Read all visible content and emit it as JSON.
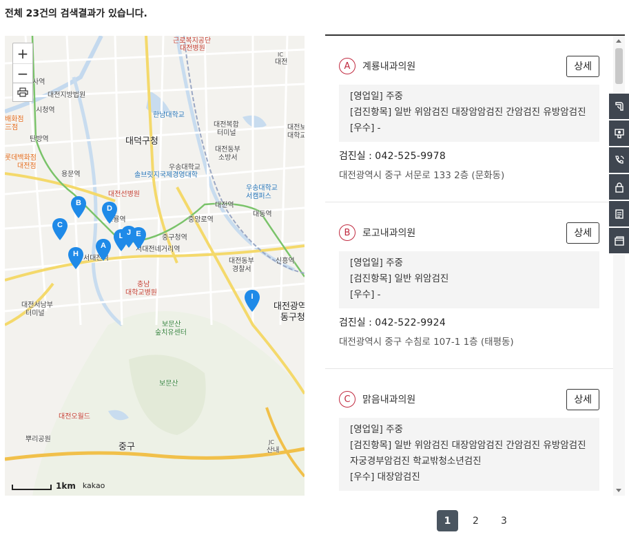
{
  "summary": "전체 23건의 검색결과가 있습니다.",
  "map": {
    "zoom_in": "+",
    "zoom_out": "−",
    "scale": "1km",
    "provider": "kakao",
    "labels": {
      "geunro": "근로복지공단",
      "daejeon_hosp": "대전병원",
      "ic": "IC",
      "daejeon_r": "대전",
      "sayeok": "사역",
      "court": "대전지방법원",
      "city_hall": "시청역",
      "hannam": "한남대학교",
      "terminal": "대전복합",
      "terminal2": "터미널",
      "dept_store": "대전보",
      "dept_store2": "대학교",
      "baekhwa": "배화점",
      "three": "三점",
      "tanbang": "탄방역",
      "daedeok": "대덕구청",
      "dongbu": "대전동부",
      "fire": "소방서",
      "lotte": "롯데백화점",
      "lotte2": "대전점",
      "woosong": "우송대학교",
      "sol": "솔브릿지국제경영대학",
      "yongmun": "용문역",
      "seon_hosp": "대전선병원",
      "woosong2": "우송대학교",
      "woosong2b": "서캠퍼스",
      "daejeon_st": "대전역",
      "dong_st": "대동역",
      "ojeong": "오룡역",
      "jungang": "중앙로역",
      "junggu": "중구청역",
      "seodae": "서대전역",
      "negeori": "서대전네거리역",
      "dongbu_police": "대전동부",
      "dongbu_police2": "경찰서",
      "sinheung": "신흥역",
      "chungnam": "충남",
      "chungnam2": "대학교병원",
      "donggu": "대전광역",
      "donggu2": "동구청",
      "seonam": "대전서남부",
      "seonam2": "터미널",
      "bomunsan": "보문산",
      "bomunsan2": "숲치유센터",
      "bomun_peak": "보문산",
      "oworld": "대전오월드",
      "ppuri": "뿌리공원",
      "jung": "중구",
      "jc": "JC",
      "sannae": "산내"
    },
    "markers": [
      "A",
      "B",
      "C",
      "D",
      "E",
      "H",
      "I",
      "J",
      "L"
    ]
  },
  "results": [
    {
      "letter": "A",
      "name": "계룡내과의원",
      "detail_label": "상세",
      "business_days": "[영업일] 주중",
      "exam_items": "[검진항목] 일반 위암검진 대장암암검진 간암검진 유방암검진",
      "excellent": "[우수] -",
      "phone_label": "검진실 :",
      "phone": "042-525-9978",
      "address": "대전광역시 중구 서문로 133 2층 (문화동)"
    },
    {
      "letter": "B",
      "name": "로고내과의원",
      "detail_label": "상세",
      "business_days": "[영업일] 주중",
      "exam_items": "[검진항목] 일반 위암검진",
      "excellent": "[우수] -",
      "phone_label": "검진실 :",
      "phone": "042-522-9924",
      "address": "대전광역시 중구 수침로 107-1 1층 (태평동)"
    },
    {
      "letter": "C",
      "name": "맑음내과의원",
      "detail_label": "상세",
      "business_days": "[영업일] 주중",
      "exam_items": "[검진항목] 일반 위암검진 대장암암검진 간암검진 유방암검진 자궁경부암검진 학교밖청소년검진",
      "excellent": "[우수] 대장암검진",
      "phone_label": "",
      "phone": "",
      "address": ""
    }
  ],
  "side_tools": [
    "sms-icon",
    "video-consult-icon",
    "phone-consult-icon",
    "lock-icon",
    "document-icon",
    "wallet-icon"
  ],
  "pagination": {
    "pages": [
      "1",
      "2",
      "3"
    ],
    "current": "1"
  },
  "colors": {
    "marker": "#1f8ae8",
    "letter_ring": "#c0283e",
    "active_page": "#4a5560",
    "side_toolbar": "#3f4650"
  }
}
